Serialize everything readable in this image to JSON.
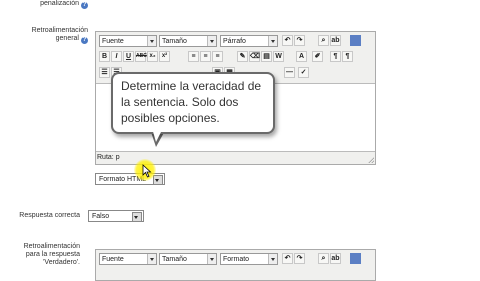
{
  "top_label": "penalización",
  "feedback_general": {
    "label_line1": "Retroalimentación",
    "label_line2": "general",
    "font_select": "Fuente",
    "size_select": "Tamaño",
    "format_select": "Párrafo",
    "path_label": "Ruta:",
    "path_value": "p",
    "format_dropdown": "Formato HTML"
  },
  "callout": {
    "line1": "Determine la veracidad de",
    "line2": "la sentencia. Solo dos",
    "line3": "posibles opciones."
  },
  "correct_answer": {
    "label": "Respuesta correcta",
    "value": "Falso"
  },
  "feedback_true": {
    "label_line1": "Retroalimentación",
    "label_line2": "para la respuesta",
    "label_line3": "'Verdadero'.",
    "font_select": "Fuente",
    "size_select": "Tamaño",
    "format_select": "Formato"
  },
  "toolbar": {
    "bold": "B",
    "italic": "I",
    "underline": "U",
    "strike": "ABC",
    "subscript": "x₂",
    "superscript": "x²"
  }
}
